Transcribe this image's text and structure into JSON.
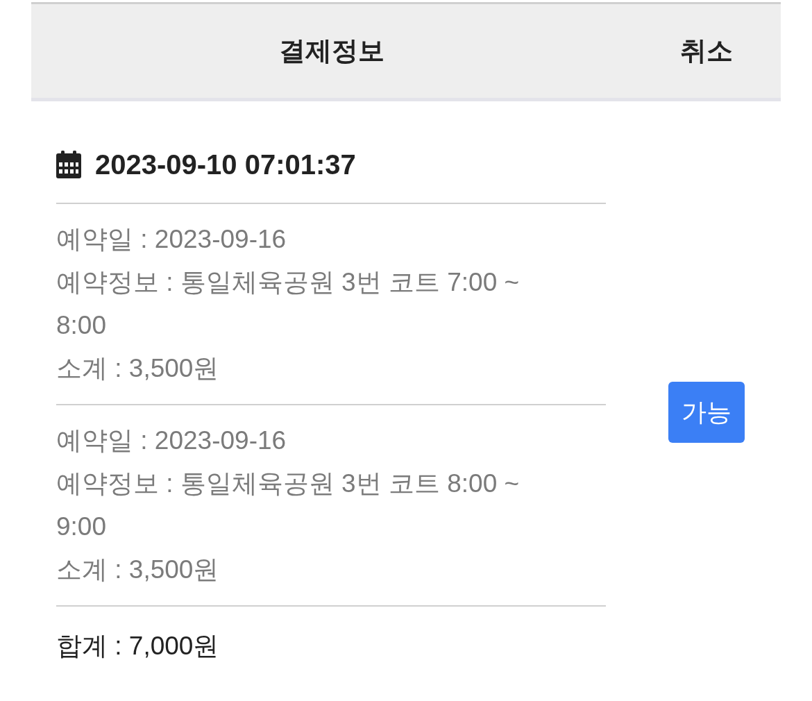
{
  "table": {
    "columns": [
      "결제정보",
      "취소"
    ],
    "rows": [
      {
        "payment_time": "2023-09-10 07:01:37",
        "items": [
          {
            "lines": [
              "예약일 : 2023-09-16",
              "예약정보 : 통일체육공원 3번 코트 7:00 ~ 8:00",
              "소계 : 3,500원"
            ]
          },
          {
            "lines": [
              "예약일 : 2023-09-16",
              "예약정보 : 통일체육공원 3번 코트 8:00 ~ 9:00",
              "소계 : 3,500원"
            ]
          }
        ],
        "total": "합계 : 7,000원",
        "cancel_button": "가능"
      }
    ]
  }
}
